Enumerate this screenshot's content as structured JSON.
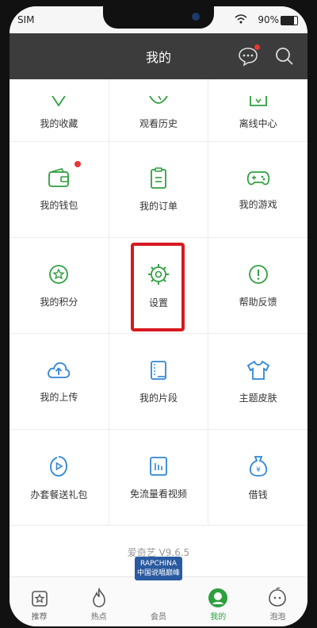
{
  "status_bar": {
    "carrier": "SIM",
    "battery": "90%"
  },
  "header": {
    "title": "我的"
  },
  "grid": {
    "rows": [
      [
        {
          "label": "我的收藏",
          "icon": "star-bookmark-icon"
        },
        {
          "label": "观看历史",
          "icon": "history-clock-icon"
        },
        {
          "label": "离线中心",
          "icon": "download-icon"
        }
      ],
      [
        {
          "label": "我的钱包",
          "icon": "wallet-icon",
          "badge": true
        },
        {
          "label": "我的订单",
          "icon": "order-clipboard-icon"
        },
        {
          "label": "我的游戏",
          "icon": "gamepad-icon"
        }
      ],
      [
        {
          "label": "我的积分",
          "icon": "points-icon"
        },
        {
          "label": "设置",
          "icon": "settings-gear-icon",
          "highlighted": true
        },
        {
          "label": "帮助反馈",
          "icon": "help-feedback-icon"
        }
      ],
      [
        {
          "label": "我的上传",
          "icon": "cloud-upload-icon"
        },
        {
          "label": "我的片段",
          "icon": "film-clip-icon"
        },
        {
          "label": "主题皮肤",
          "icon": "tshirt-theme-icon"
        }
      ],
      [
        {
          "label": "办套餐送礼包",
          "icon": "play-drop-icon"
        },
        {
          "label": "免流量看视频",
          "icon": "video-file-icon"
        },
        {
          "label": "借钱",
          "icon": "money-bag-icon"
        }
      ]
    ]
  },
  "version": "爱奇艺 V9.6.5",
  "tabbar": {
    "tabs": [
      {
        "label": "推荐",
        "icon": "home-recommend-icon"
      },
      {
        "label": "热点",
        "icon": "hot-flame-icon"
      },
      {
        "label": "会员",
        "icon": "vip-icon",
        "promo_line1": "RAPCHINA",
        "promo_line2": "中国说唱巅峰"
      },
      {
        "label": "我的",
        "icon": "my-profile-icon",
        "active": true
      },
      {
        "label": "泡泡",
        "icon": "bubble-icon"
      }
    ]
  },
  "colors": {
    "accent": "#2e9f3e",
    "blue_icon": "#2f86d6",
    "header": "#3c3c3c",
    "highlight": "#d71920"
  }
}
